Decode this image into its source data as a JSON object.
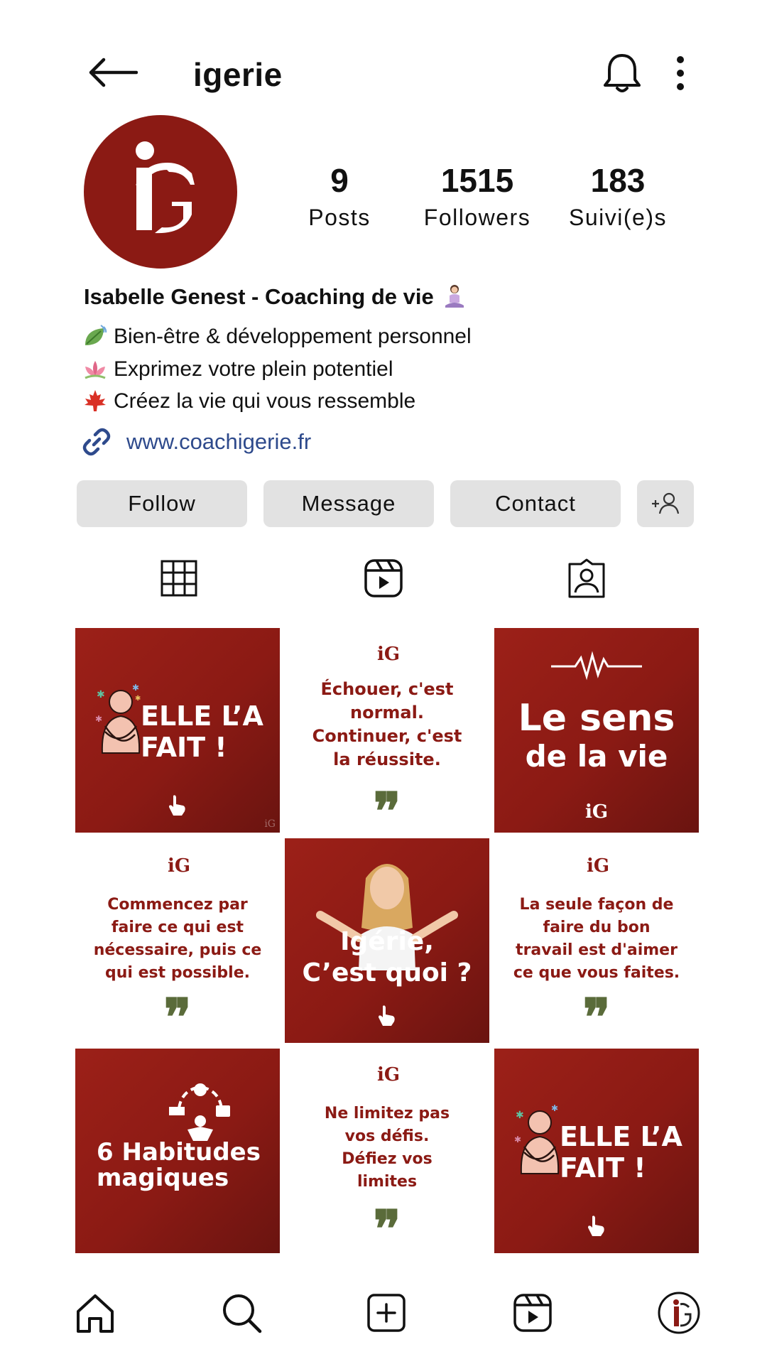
{
  "header": {
    "username": "igerie"
  },
  "profile": {
    "stats": [
      {
        "value": "9",
        "label": "Posts"
      },
      {
        "value": "1515",
        "label": "Followers"
      },
      {
        "value": "183",
        "label": "Suivi(e)s"
      }
    ],
    "name": "Isabelle Genest - Coaching de vie",
    "bio_lines": [
      {
        "icon": "leaf-icon",
        "text": "Bien-être & développement personnel"
      },
      {
        "icon": "lotus-icon",
        "text": "Exprimez votre plein potentiel"
      },
      {
        "icon": "maple-leaf-icon",
        "text": "Créez la vie qui vous ressemble"
      }
    ],
    "link": "www.coachigerie.fr"
  },
  "buttons": {
    "follow": "Follow",
    "message": "Message",
    "contact": "Contact"
  },
  "posts": [
    {
      "type": "image",
      "text_line1": "ELLE L’A",
      "text_line2": "FAIT !"
    },
    {
      "type": "quote",
      "text": [
        "Échouer, c'est",
        "normal.",
        "Continuer, c'est",
        "la réussite."
      ]
    },
    {
      "type": "image",
      "text_line1": "Le sens",
      "text_line2": "de la vie"
    },
    {
      "type": "quote",
      "text": [
        "Commencez par",
        "faire ce qui est",
        "nécessaire, puis ce",
        "qui est possible."
      ]
    },
    {
      "type": "image",
      "text_line1": "Igérie,",
      "text_line2": "C’est quoi ?"
    },
    {
      "type": "quote",
      "text": [
        "La seule façon de",
        "faire du bon",
        "travail est d'aimer",
        "ce que vous faites."
      ]
    },
    {
      "type": "image",
      "text_line1": "6 Habitudes",
      "text_line2": "magiques"
    },
    {
      "type": "quote",
      "text": [
        "Ne limitez pas",
        "vos défis.",
        "Défiez vos",
        "limites"
      ]
    },
    {
      "type": "image",
      "text_line1": "ELLE L’A",
      "text_line2": "FAIT !"
    }
  ],
  "quote_mark": "❞",
  "colors": {
    "brand_red": "#8b1a14",
    "quote_green": "#5a6b3a",
    "link_blue": "#2e4a8c",
    "button_gray": "#e2e2e2"
  }
}
